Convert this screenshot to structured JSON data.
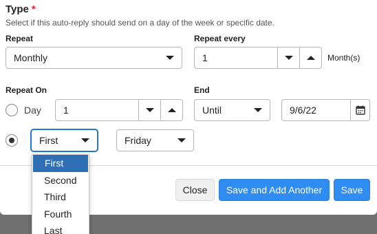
{
  "type": {
    "title": "Type",
    "required_mark": "*",
    "description": "Select if this auto-reply should send on a day of the week or specific date."
  },
  "repeat": {
    "label": "Repeat",
    "value": "Monthly"
  },
  "repeat_every": {
    "label": "Repeat every",
    "value": "1",
    "unit": "Month(s)"
  },
  "repeat_on": {
    "label": "Repeat On",
    "day_option": {
      "label": "Day",
      "value": "1",
      "selected": false
    },
    "week_option": {
      "selected": true,
      "ordinal": "First",
      "weekday": "Friday"
    }
  },
  "end": {
    "label": "End",
    "mode": "Until",
    "date": "9/6/22"
  },
  "ordinal_dropdown": {
    "options": [
      "First",
      "Second",
      "Third",
      "Fourth",
      "Last"
    ],
    "highlighted": "First"
  },
  "footer": {
    "close_label": "Close",
    "save_add_label": "Save and Add Another",
    "save_label": "Save"
  },
  "colors": {
    "primary": "#2f8cf0",
    "highlight": "#2f6fb5",
    "required": "#e0242f",
    "overlay": "#6f6f6f"
  }
}
